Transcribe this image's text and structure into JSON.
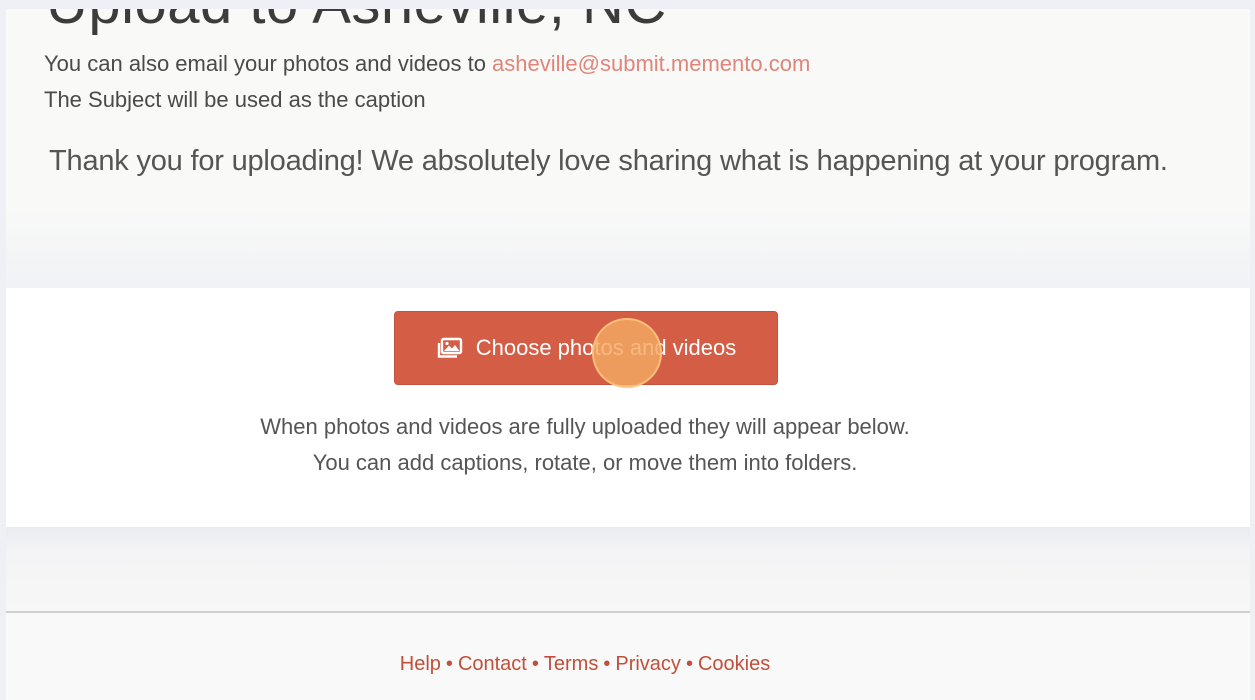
{
  "header": {
    "title": "Upload to Asheville, NC",
    "email_prefix": "You can also email your photos and videos to ",
    "email_address": "asheville@submit.memento.com",
    "subject_note": "The Subject will be used as the caption",
    "thanks": "Thank you for uploading! We absolutely love sharing what is happening at your program."
  },
  "upload": {
    "button_label": "Choose photos and videos",
    "button_icon": "photos-icon",
    "info_line_1": "When photos and videos are fully uploaded they will appear below.",
    "info_line_2": "You can add captions, rotate, or move them into folders."
  },
  "footer": {
    "links": [
      "Help",
      "Contact",
      "Terms",
      "Privacy",
      "Cookies"
    ],
    "separator": "•"
  },
  "colors": {
    "accent": "#d45d46",
    "link": "#c0503a",
    "email": "#e0857a"
  }
}
